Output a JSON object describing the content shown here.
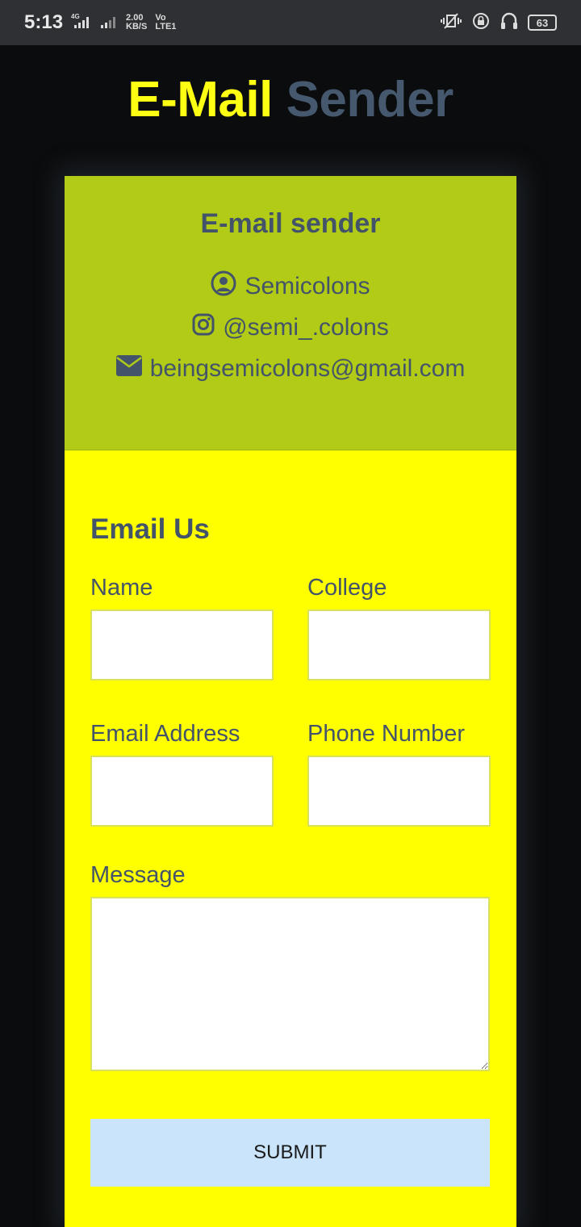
{
  "status_bar": {
    "time": "5:13",
    "network_1": "4G",
    "speed_value": "2.00",
    "speed_unit": "KB/S",
    "network_2_top": "Vo",
    "network_2_bottom": "LTE1",
    "battery": "63"
  },
  "header": {
    "title_part1": "E-Mail",
    "title_part2": "Sender"
  },
  "info_card": {
    "heading": "E-mail sender",
    "name": "Semicolons",
    "instagram": "@semi_.colons",
    "email": "beingsemicolons@gmail.com"
  },
  "form": {
    "heading": "Email Us",
    "name_label": "Name",
    "college_label": "College",
    "email_label": "Email Address",
    "phone_label": "Phone Number",
    "message_label": "Message",
    "submit_label": "SUBMIT"
  },
  "colors": {
    "title_accent": "#ffff14",
    "title_muted": "#45586e",
    "info_bg": "#b2cb16",
    "form_bg": "#ffff00",
    "submit_bg": "#c9e4fb"
  }
}
